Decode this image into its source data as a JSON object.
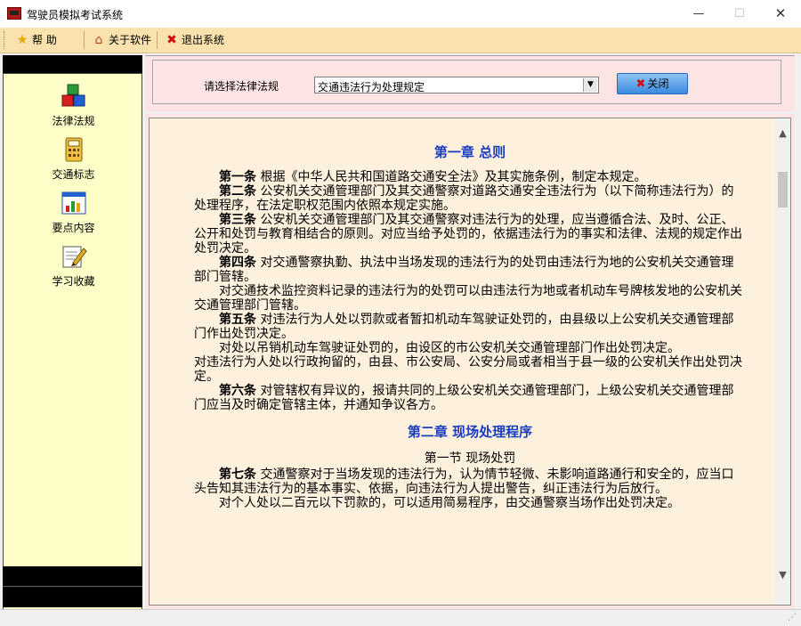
{
  "window": {
    "title": "驾驶员模拟考试系统"
  },
  "toolbar": {
    "help": "帮  助",
    "about": "关于软件",
    "exit": "退出系统"
  },
  "sidebar": {
    "items": [
      {
        "label": "法律法规",
        "icon": "cubes-icon"
      },
      {
        "label": "交通标志",
        "icon": "calculator-icon"
      },
      {
        "label": "要点内容",
        "icon": "bar-chart-icon"
      },
      {
        "label": "学习收藏",
        "icon": "notepad-pencil-icon"
      }
    ]
  },
  "selector": {
    "label": "请选择法律法规",
    "value": "交通违法行为处理规定",
    "close_label": "关闭"
  },
  "document": {
    "chapter1": "第一章 总则",
    "a1_num": "第一条",
    "a1": " 根据《中华人民共和国道路交通安全法》及其实施条例，制定本规定。",
    "a2_num": "第二条",
    "a2": " 公安机关交通管理部门及其交通警察对道路交通安全违法行为（以下简称违法行为）的处理程序，在法定职权范围内依照本规定实施。",
    "a3_num": "第三条",
    "a3": " 公安机关交通管理部门及其交通警察对违法行为的处理，应当遵循合法、及时、公正、公开和处罚与教育相结合的原则。对应当给予处罚的，依据违法行为的事实和法律、法规的规定作出处罚决定。",
    "a4_num": "第四条",
    "a4": " 对交通警察执勤、执法中当场发现的违法行为的处罚由违法行为地的公安机关交通管理部门管辖。",
    "a4b": "对交通技术监控资料记录的违法行为的处罚可以由违法行为地或者机动车号牌核发地的公安机关交通管理部门管辖。",
    "a5_num": "第五条",
    "a5": " 对违法行为人处以罚款或者暂扣机动车驾驶证处罚的，由县级以上公安机关交通管理部门作出处罚决定。",
    "a5b": "对处以吊销机动车驾驶证处罚的，由设区的市公安机关交通管理部门作出处罚决定。",
    "a5c": "对违法行为人处以行政拘留的，由县、市公安局、公安分局或者相当于县一级的公安机关作出处罚决定。",
    "a6_num": "第六条",
    "a6": " 对管辖权有异议的，报请共同的上级公安机关交通管理部门，上级公安机关交通管理部门应当及时确定管辖主体，并通知争议各方。",
    "chapter2": "第二章 现场处理程序",
    "section1": "第一节 现场处罚",
    "a7_num": "第七条",
    "a7": " 交通警察对于当场发现的违法行为，认为情节轻微、未影响道路通行和安全的，应当口头告知其违法行为的基本事实、依据，向违法行为人提出警告，纠正违法行为后放行。",
    "a7b": "对个人处以二百元以下罚款的，可以适用简易程序，由交通警察当场作出处罚决定。"
  },
  "colors": {
    "toolbar_bg": "#fae2ae",
    "sidebar_bg": "#fefec8",
    "panel_bg": "#fde4e4",
    "doc_bg": "#fdf1de",
    "chapter_color": "#1a3cc0"
  }
}
